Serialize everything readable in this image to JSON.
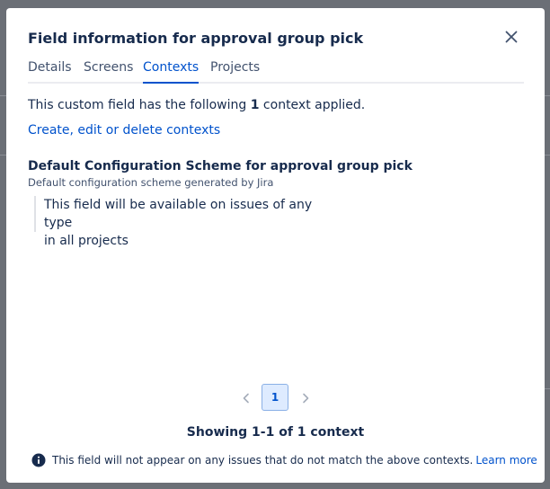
{
  "dialog": {
    "title": "Field information for approval group pick",
    "close_icon": "close-icon"
  },
  "tabs": [
    {
      "label": "Details",
      "active": false
    },
    {
      "label": "Screens",
      "active": false
    },
    {
      "label": "Contexts",
      "active": true
    },
    {
      "label": "Projects",
      "active": false
    }
  ],
  "contexts": {
    "summary_before": "This custom field has the following ",
    "summary_count": "1",
    "summary_after": " context applied.",
    "manage_link": "Create, edit or delete contexts",
    "scheme": {
      "name": "Default Configuration Scheme for approval group pick",
      "description": "Default configuration scheme generated by Jira",
      "availability_line1": "This field will be available on issues of any type",
      "availability_line2": "in all projects"
    }
  },
  "pagination": {
    "current_page": "1",
    "showing": "Showing 1-1 of 1 context"
  },
  "footer": {
    "info_text": "This field will not appear on any issues that do not match the above contexts.",
    "learn_more": "Learn more"
  },
  "colors": {
    "accent": "#0052cc",
    "text": "#172b4d",
    "overlay": "#6b6f76"
  }
}
